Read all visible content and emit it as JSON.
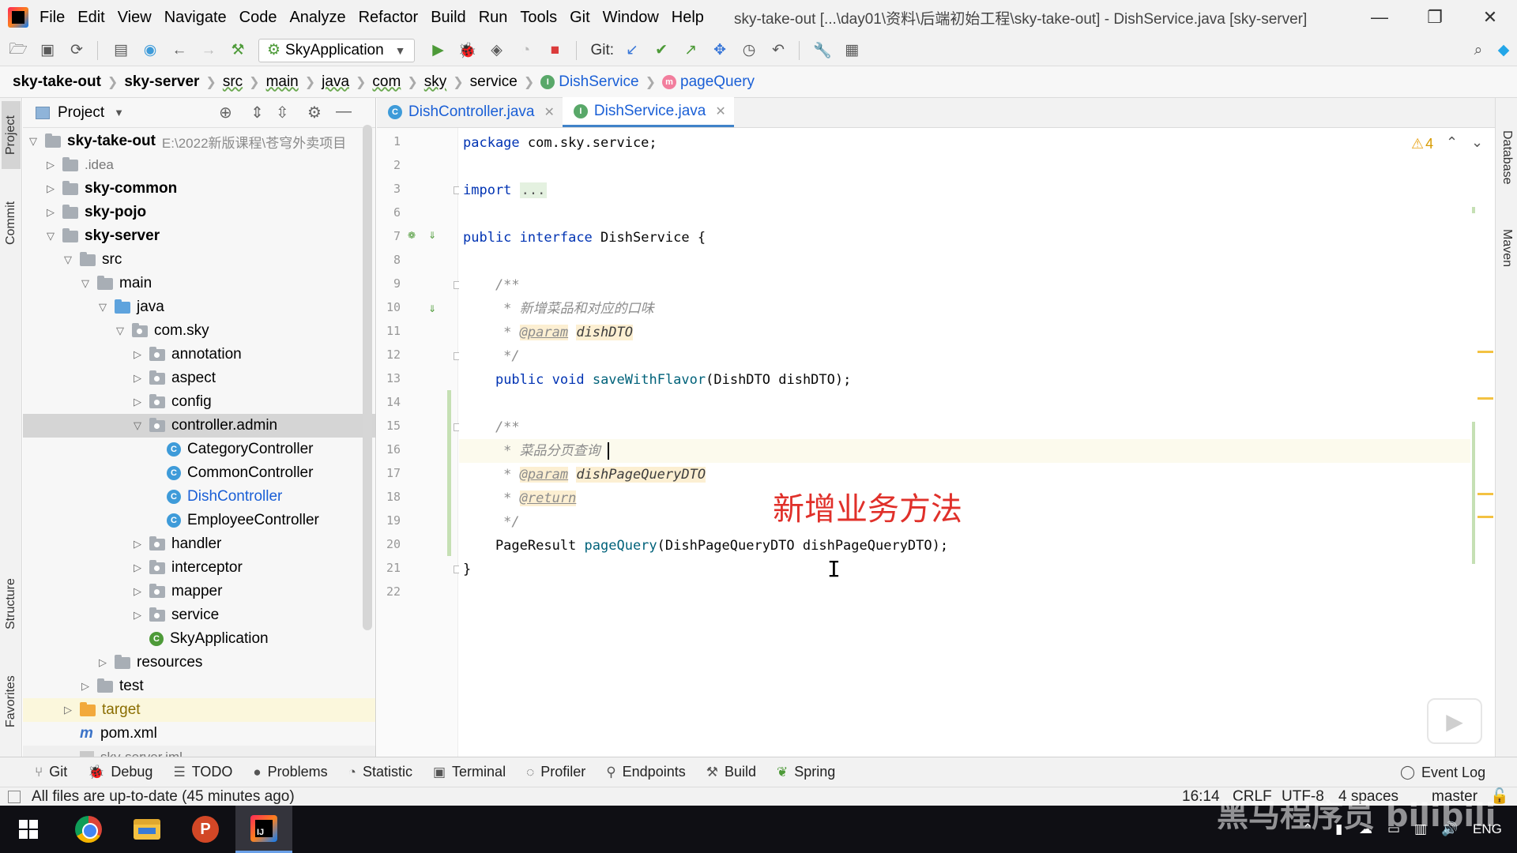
{
  "titlebar": {
    "menu": [
      "File",
      "Edit",
      "View",
      "Navigate",
      "Code",
      "Analyze",
      "Refactor",
      "Build",
      "Run",
      "Tools",
      "Git",
      "Window",
      "Help"
    ],
    "window_title": "sky-take-out [...\\day01\\资料\\后端初始工程\\sky-take-out] - DishService.java [sky-server]",
    "controls": {
      "minimize": "—",
      "restore": "❐",
      "close": "✕"
    }
  },
  "toolbar": {
    "run_config": "SkyApplication",
    "git_label": "Git:"
  },
  "breadcrumb": {
    "items": [
      "sky-take-out",
      "sky-server",
      "src",
      "main",
      "java",
      "com",
      "sky",
      "service",
      "DishService",
      "pageQuery"
    ]
  },
  "left_strip": {
    "project": "Project",
    "commit": "Commit",
    "structure": "Structure",
    "favorites": "Favorites"
  },
  "right_strip": {
    "database": "Database",
    "maven": "Maven"
  },
  "project_panel": {
    "title": "Project",
    "tree": [
      {
        "label": "sky-take-out",
        "path": "E:\\2022新版课程\\苍穹外卖项目"
      },
      {
        "label": ".idea"
      },
      {
        "label": "sky-common"
      },
      {
        "label": "sky-pojo"
      },
      {
        "label": "sky-server"
      },
      {
        "label": "src"
      },
      {
        "label": "main"
      },
      {
        "label": "java"
      },
      {
        "label": "com.sky"
      },
      {
        "label": "annotation"
      },
      {
        "label": "aspect"
      },
      {
        "label": "config"
      },
      {
        "label": "controller.admin"
      },
      {
        "label": "CategoryController"
      },
      {
        "label": "CommonController"
      },
      {
        "label": "DishController"
      },
      {
        "label": "EmployeeController"
      },
      {
        "label": "handler"
      },
      {
        "label": "interceptor"
      },
      {
        "label": "mapper"
      },
      {
        "label": "service"
      },
      {
        "label": "SkyApplication"
      },
      {
        "label": "resources"
      },
      {
        "label": "test"
      },
      {
        "label": "target"
      },
      {
        "label": "pom.xml"
      },
      {
        "label": "sky-server.iml"
      }
    ]
  },
  "editor": {
    "tabs": [
      {
        "label": "DishController.java",
        "active": false
      },
      {
        "label": "DishService.java",
        "active": true
      }
    ],
    "line_numbers": [
      "1",
      "2",
      "3",
      "6",
      "7",
      "8",
      "9",
      "10",
      "11",
      "12",
      "13",
      "14",
      "15",
      "16",
      "17",
      "18",
      "19",
      "20",
      "21",
      "22"
    ],
    "code": {
      "l1_kw": "package",
      "l1_rest": " com.sky.service;",
      "l3_kw": "import",
      "l3_dots": "...",
      "l7_kw1": "public",
      "l7_kw2": "interface",
      "l7_rest": " DishService {",
      "l9": "    /**",
      "l10": "     * 新增菜品和对应的口味",
      "l11_star": "     * ",
      "l11_tag": "@param",
      "l11_param": "dishDTO",
      "l12": "     */",
      "l13_indent": "    ",
      "l13_kw1": "public",
      "l13_kw2": "void",
      "l13_fn": "saveWithFlavor",
      "l13_rest": "(DishDTO dishDTO);",
      "l15": "    /**",
      "l16": "     * 菜品分页查询",
      "l17_star": "     * ",
      "l17_tag": "@param",
      "l17_param": "dishPageQueryDTO",
      "l18_star": "     * ",
      "l18_tag": "@return",
      "l19": "     */",
      "l20_indent": "    PageResult ",
      "l20_fn": "pageQuery",
      "l20_rest": "(DishPageQueryDTO dishPageQueryDTO);",
      "l21": "}"
    },
    "warning_count": "4",
    "annotation": "新增业务方法"
  },
  "bottom_tools": [
    "Git",
    "Debug",
    "TODO",
    "Problems",
    "Statistic",
    "Terminal",
    "Profiler",
    "Endpoints",
    "Build",
    "Spring"
  ],
  "event_log": "Event Log",
  "status": {
    "message": "All files are up-to-date (45 minutes ago)",
    "position": "16:14",
    "line_sep": "CRLF",
    "encoding": "UTF-8",
    "indent": "4 spaces",
    "branch": "master"
  },
  "taskbar": {
    "lang": "ENG"
  },
  "watermark": "黑马程序员 bilibili"
}
